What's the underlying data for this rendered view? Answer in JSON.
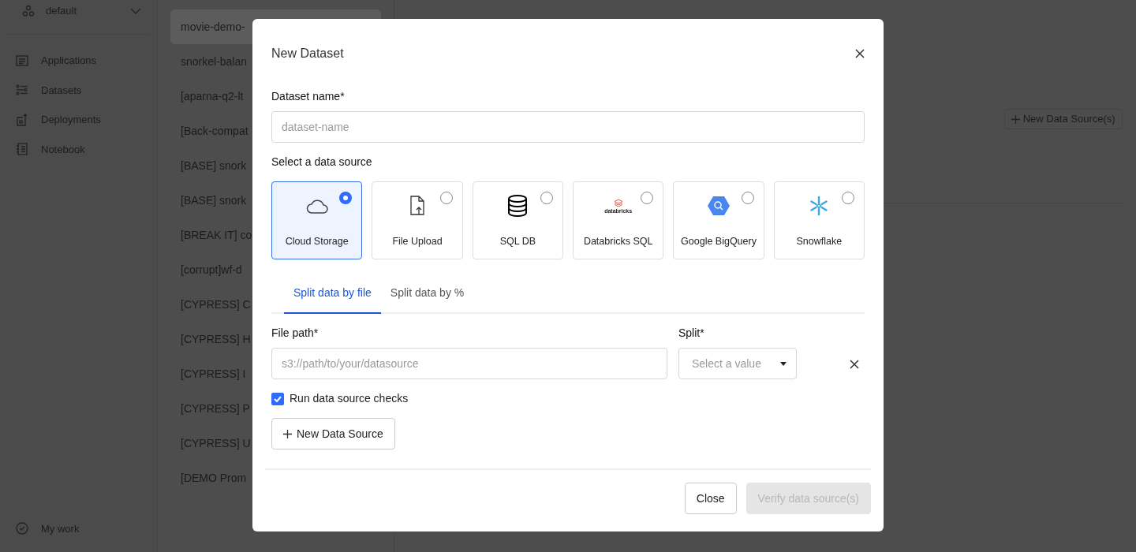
{
  "sidebar": {
    "workspace": "default",
    "nav_items": [
      {
        "label": "Applications"
      },
      {
        "label": "Datasets"
      },
      {
        "label": "Deployments"
      },
      {
        "label": "Notebook"
      }
    ],
    "footer_item": "My work"
  },
  "dataset_list": [
    {
      "label": "movie-demo-",
      "selected": true
    },
    {
      "label": "snorkel-balan",
      "selected": false
    },
    {
      "label": "[aparna-q2-lt",
      "selected": false
    },
    {
      "label": "[Back-compat",
      "selected": false
    },
    {
      "label": "[BASE] snork",
      "selected": false
    },
    {
      "label": "[BASE] snork",
      "selected": false
    },
    {
      "label": "[BREAK IT] co",
      "selected": false
    },
    {
      "label": "[corrupt]wf-d",
      "selected": false
    },
    {
      "label": "[CYPRESS] C",
      "selected": false
    },
    {
      "label": "[CYPRESS] H",
      "selected": false
    },
    {
      "label": "[CYPRESS] I",
      "selected": false
    },
    {
      "label": "[CYPRESS] P",
      "selected": false
    },
    {
      "label": "[CYPRESS] U",
      "selected": false
    },
    {
      "label": "[DEMO Prom",
      "selected": false
    }
  ],
  "detail": {
    "new_source_button": "New Data Source(s)"
  },
  "modal": {
    "title": "New Dataset",
    "dataset_name": {
      "label": "Dataset name*",
      "placeholder": "dataset-name"
    },
    "source_prompt": "Select a data source",
    "sources": [
      {
        "label": "Cloud Storage",
        "selected": true
      },
      {
        "label": "File Upload",
        "selected": false
      },
      {
        "label": "SQL DB",
        "selected": false
      },
      {
        "label": "Databricks SQL",
        "selected": false,
        "logo_text": "databricks"
      },
      {
        "label": "Google BigQuery",
        "selected": false
      },
      {
        "label": "Snowflake",
        "selected": false
      }
    ],
    "tabs": [
      {
        "label": "Split data by file",
        "selected": true
      },
      {
        "label": "Split data by %",
        "selected": false
      }
    ],
    "file_path": {
      "label": "File path*",
      "placeholder": "s3://path/to/your/datasource"
    },
    "split": {
      "label": "Split*",
      "placeholder": "Select a value"
    },
    "run_checks": {
      "label": "Run data source checks",
      "checked": true
    },
    "new_source_button": "New Data Source",
    "footer_buttons": [
      {
        "label": "Close",
        "disabled": false
      },
      {
        "label": "Verify data source(s)",
        "disabled": true
      }
    ]
  }
}
